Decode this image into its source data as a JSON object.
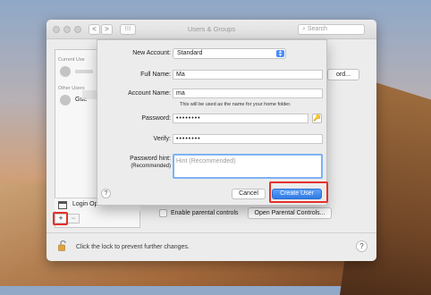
{
  "window": {
    "title": "Users & Groups",
    "search_placeholder": "Search",
    "nav_back": "<",
    "nav_forward": ">",
    "grid_icon": "grid-icon"
  },
  "sidebar": {
    "current_users_label": "Current Use",
    "other_users_label": "Other Users",
    "guest_label": "Gue",
    "login_options": "Login Options",
    "add_label": "+",
    "remove_label": "−"
  },
  "background": {
    "right_button": "ord...",
    "parental_checkbox_label": "Enable parental controls",
    "parental_button": "Open Parental Controls...",
    "lock_text": "Click the lock to prevent further changes.",
    "help": "?"
  },
  "sheet": {
    "new_account_label": "New Account:",
    "new_account_value": "Standard",
    "full_name_label": "Full Name:",
    "full_name_value": "Ma",
    "account_name_label": "Account Name:",
    "account_name_value": "ma",
    "account_note": "This will be used as the name for your home folder.",
    "password_label": "Password:",
    "password_value": "••••••••",
    "verify_label": "Verify:",
    "verify_value": "••••••••",
    "hint_label": "Password hint:",
    "hint_sublabel": "(Recommended)",
    "hint_placeholder": "Hint (Recommended)",
    "help": "?",
    "cancel": "Cancel",
    "create": "Create User"
  },
  "colors": {
    "accent": "#2f7ae6",
    "highlight": "#e4312b"
  }
}
